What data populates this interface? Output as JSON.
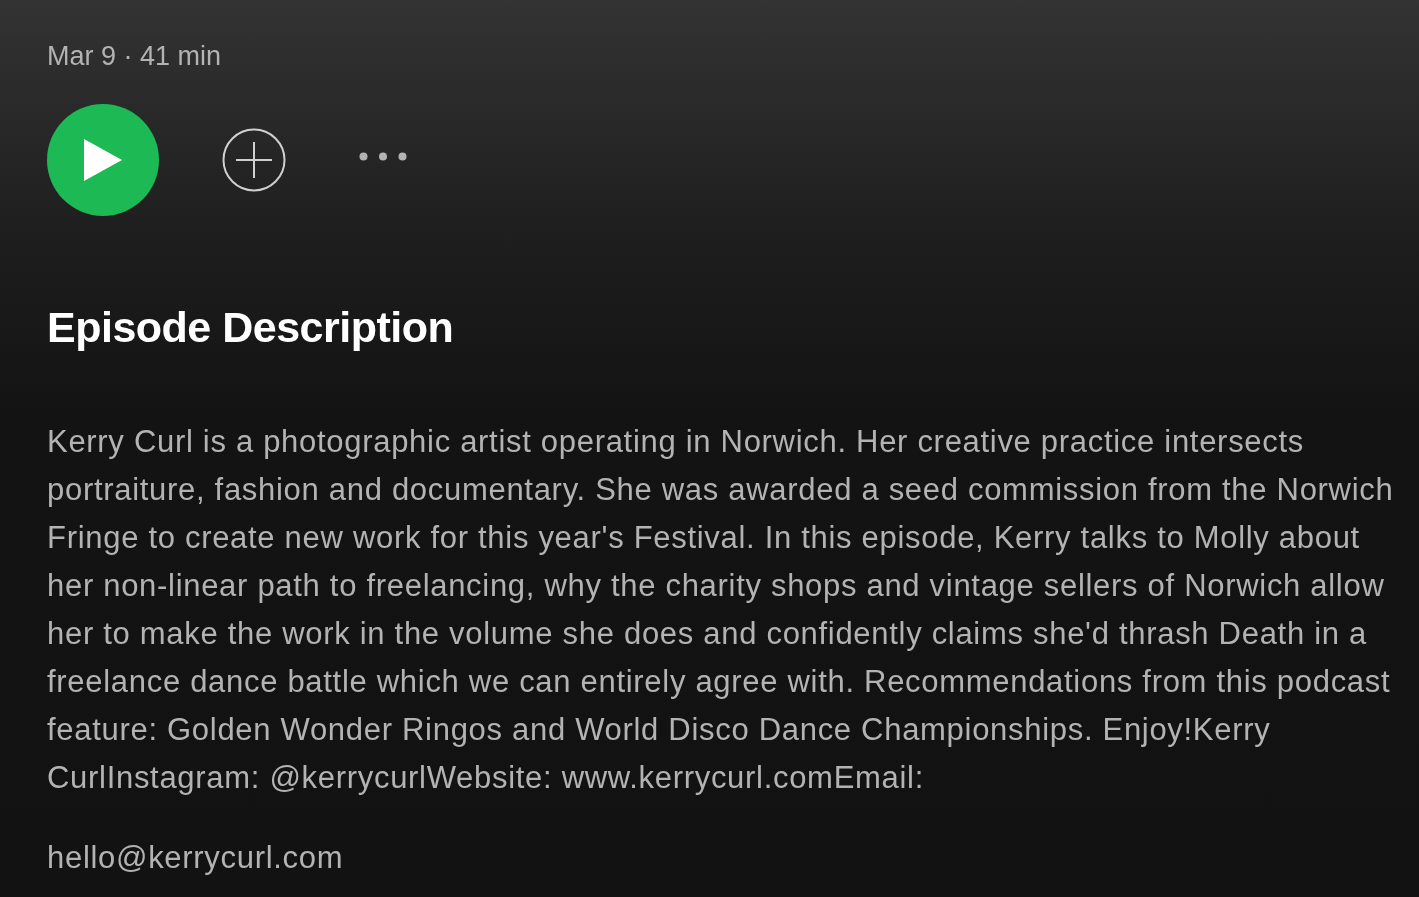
{
  "episode": {
    "meta": "Mar 9 · 41 min"
  },
  "description": {
    "heading": "Episode Description",
    "paragraphs": [
      "Kerry Curl is a photographic artist operating in Norwich. Her creative practice intersects portraiture, fashion and documentary. She was awarded a seed commission from the Norwich Fringe to create new work for this year's Festival. In this episode, Kerry talks to Molly about her non-linear path to freelancing, why the charity shops and vintage sellers of Norwich allow her to make the work in the volume she does and confidently claims she'd thrash Death in a freelance dance battle which we can entirely agree with. Recommendations from this podcast feature: Golden Wonder Ringos and World Disco Dance Championships. Enjoy!Kerry CurlInstagram: @kerrycurlWebsite: www.kerrycurl.comEmail:",
      "hello@kerrycurl.com"
    ]
  }
}
